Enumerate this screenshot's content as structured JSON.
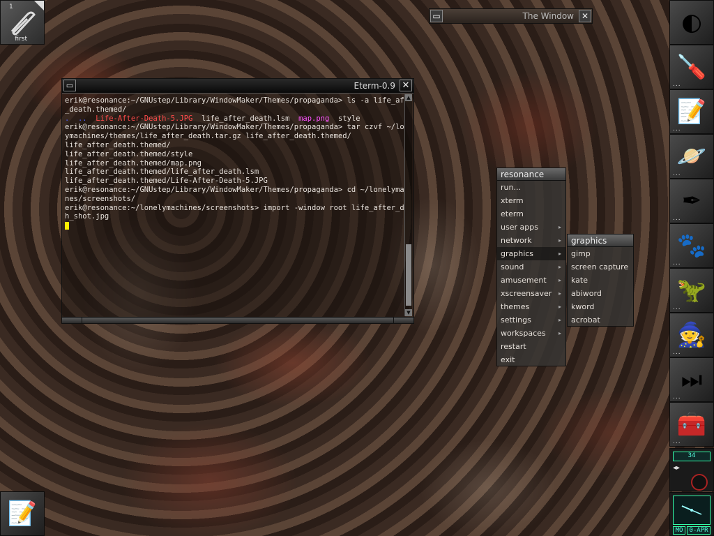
{
  "clip": {
    "workspace_number": "1",
    "workspace_name": "first"
  },
  "miniwindow": {
    "title": "The Window",
    "close": "✕",
    "menu": "▭"
  },
  "eterm": {
    "title": "Eterm-0.9",
    "lines": [
      [
        {
          "t": "erik@resonance:~/GNUstep/Library/WindowMaker/Themes/propaganda> ls -a life_after"
        }
      ],
      [
        {
          "t": "_death.themed/"
        }
      ],
      [
        {
          "t": ".  ..  ",
          "c": "dir"
        },
        {
          "t": "Life-After-Death-5.JPG",
          "c": "jpg"
        },
        {
          "t": "  life_after_death.lsm  "
        },
        {
          "t": "map.png",
          "c": "png"
        },
        {
          "t": "  style"
        }
      ],
      [
        {
          "t": "erik@resonance:~/GNUstep/Library/WindowMaker/Themes/propaganda> tar czvf ~/lonel"
        }
      ],
      [
        {
          "t": "ymachines/themes/life_after_death.tar.gz life_after_death.themed/"
        }
      ],
      [
        {
          "t": "life_after_death.themed/"
        }
      ],
      [
        {
          "t": "life_after_death.themed/style"
        }
      ],
      [
        {
          "t": "life_after_death.themed/map.png"
        }
      ],
      [
        {
          "t": "life_after_death.themed/life_after_death.lsm"
        }
      ],
      [
        {
          "t": "life_after_death.themed/Life-After-Death-5.JPG"
        }
      ],
      [
        {
          "t": "erik@resonance:~/GNUstep/Library/WindowMaker/Themes/propaganda> cd ~/lonelymachi"
        }
      ],
      [
        {
          "t": "nes/screenshots/"
        }
      ],
      [
        {
          "t": "erik@resonance:~/lonelymachines/screenshots> import -window root life_after_deat"
        }
      ],
      [
        {
          "t": "h_shot.jpg"
        }
      ]
    ]
  },
  "root_menu": {
    "title": "resonance",
    "items": [
      "run...",
      "xterm",
      "eterm",
      "user apps",
      "network",
      "graphics",
      "sound",
      "amusement",
      "xscreensaver",
      "themes",
      "settings",
      "workspaces",
      "restart",
      "exit"
    ],
    "submenu_flags": [
      false,
      false,
      false,
      true,
      true,
      true,
      true,
      true,
      true,
      true,
      true,
      true,
      false,
      false
    ],
    "selected": "graphics"
  },
  "graphics_menu": {
    "title": "graphics",
    "items": [
      "gimp",
      "screen capture",
      "kate",
      "abiword",
      "kword",
      "acrobat"
    ]
  },
  "dock": {
    "tiles": [
      {
        "icon": "gnustep-logo-icon",
        "glyph": "◐",
        "dots": false
      },
      {
        "icon": "screwdriver-preferences-icon",
        "glyph": "🪛",
        "dots": true
      },
      {
        "icon": "editor-tools-icon",
        "glyph": "📝",
        "dots": true
      },
      {
        "icon": "planets-icon",
        "glyph": "🪐",
        "dots": true
      },
      {
        "icon": "drawing-pen-icon",
        "glyph": "✒",
        "dots": true
      },
      {
        "icon": "gimp-icon",
        "glyph": "🐾",
        "dots": true
      },
      {
        "icon": "mozilla-icon",
        "glyph": "🦖",
        "dots": true
      },
      {
        "icon": "wizard-hat-icon",
        "glyph": "🧙",
        "dots": true
      },
      {
        "icon": "media-skip-icon",
        "glyph": "⏭",
        "dots": true
      },
      {
        "icon": "toolbox-icon",
        "glyph": "🧰",
        "dots": true
      }
    ],
    "dots_label": "..."
  },
  "clock": {
    "day": "MO",
    "date": "0-APR"
  },
  "status": {
    "lcd": "34"
  }
}
